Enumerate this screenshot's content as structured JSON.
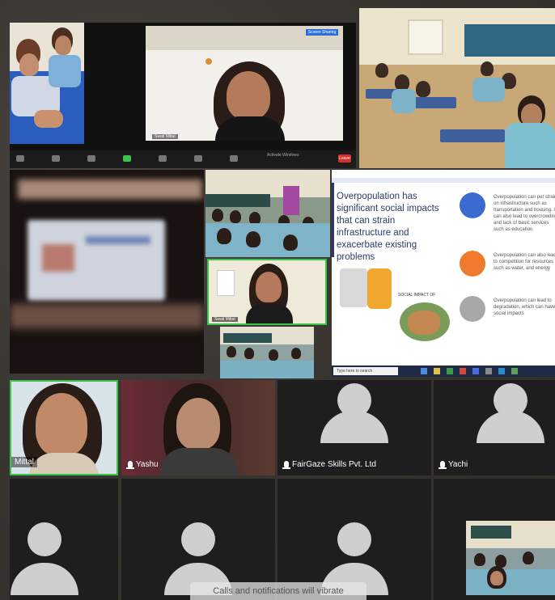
{
  "meeting": {
    "presenter_window": {
      "leave_label": "Leave",
      "recording_label": "Screen Sharing",
      "view_label": "Activate Windows",
      "participant_label": "Swati Mittal"
    },
    "slide": {
      "heading": "Overpopulation has significant social impacts that can strain infrastructure and exacerbate existing problems",
      "points": [
        {
          "color": "#3b6bd0",
          "text": "Overpopulation can put strain on infrastructure such as transportation and housing. It can also lead to overcrowding and lack of basic services such as education"
        },
        {
          "color": "#f07a2c",
          "text": "Overpopulation can also lead to competition for resources such as water, and energy"
        },
        {
          "color": "#a8a8a8",
          "text": "Overpopulation can lead to degradation, which can have social impacts"
        }
      ],
      "caption": "SOCIAL IMPACT OF",
      "taskbar_search": "Type here to search"
    },
    "pip_presenter_label": "Swati Mittal",
    "participants": [
      {
        "name": "Mittal",
        "has_video": true,
        "active": true
      },
      {
        "name": "Yashu",
        "has_video": true,
        "active": false
      },
      {
        "name": "FairGaze Skills Pvt. Ltd",
        "has_video": false,
        "active": false
      },
      {
        "name": "Yachi",
        "has_video": false,
        "active": false
      },
      {
        "name": "",
        "has_video": false
      },
      {
        "name": "",
        "has_video": false
      },
      {
        "name": "",
        "has_video": false
      },
      {
        "name": "",
        "has_video": true
      }
    ],
    "notification": "Calls and notifications will vibrate"
  },
  "colors": {
    "active_border": "#3cc24a",
    "tile_bg": "#1e1e1e",
    "slide_accent": "#2e3a66"
  }
}
